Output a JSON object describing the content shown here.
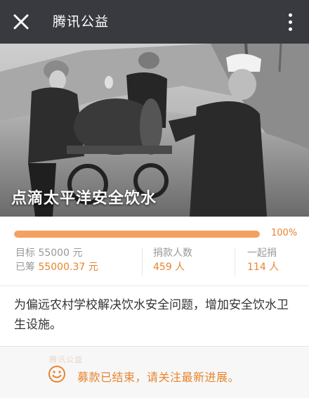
{
  "topbar": {
    "title": "腾讯公益",
    "close_icon": "close-icon",
    "menu_icon": "more-vertical-icon"
  },
  "project": {
    "title": "点滴太平洋安全饮水",
    "progress_percent": 100,
    "progress_label": "100%",
    "target_label": "目标",
    "target_value": "55000 元",
    "raised_label": "已筹",
    "raised_value": "55000.37 元",
    "donors_label": "捐款人数",
    "donors_value": "459 人",
    "together_label": "一起捐",
    "together_value": "114 人",
    "description": "为偏远农村学校解决饮水安全问题，增加安全饮水卫生设施。"
  },
  "footer": {
    "status": "募款已结束，请关注最新进展。",
    "icon": "smile-icon",
    "watermark": "腾讯公益"
  },
  "colors": {
    "accent": "#e8842e",
    "topbar": "#393a3f"
  }
}
